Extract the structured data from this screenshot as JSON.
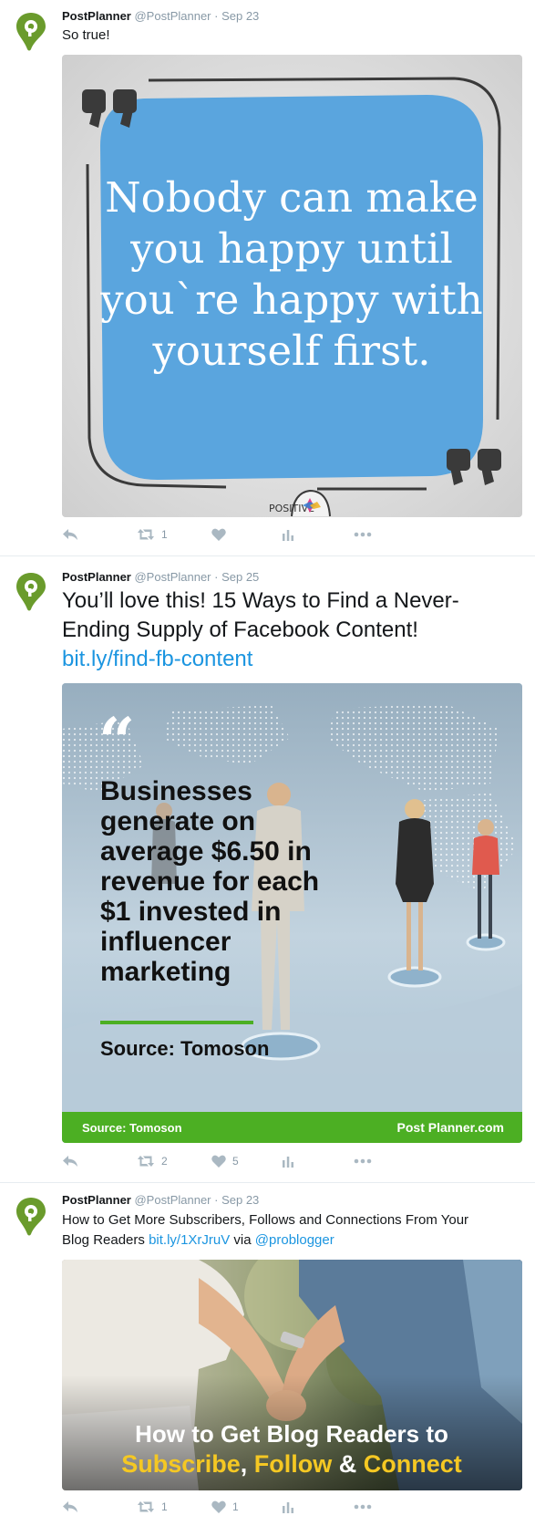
{
  "tweets": [
    {
      "name": "PostPlanner",
      "handle": "@PostPlanner",
      "date": "· Sep 23",
      "text": "So true!",
      "image": {
        "quote_lines": [
          "Nobody can make",
          "you happy until",
          "you`re happy with",
          "yourself first."
        ],
        "logo_text": "POSITIVE"
      },
      "actions": {
        "retweets": "1",
        "likes": ""
      }
    },
    {
      "name": "PostPlanner",
      "handle": "@PostPlanner",
      "date": "· Sep 25",
      "text_lines": [
        "You’ll love this! 15 Ways to Find a Never-",
        "Ending Supply of Facebook Content!"
      ],
      "link": "bit.ly/find-fb-content",
      "image": {
        "stat_lines": [
          "Businesses",
          "generate on",
          "average $6.50 in",
          "revenue for each",
          "$1 invested in",
          "influencer",
          "marketing"
        ],
        "source": "Source: Tomoson",
        "footer_left": "Source: Tomoson",
        "footer_right": "Post Planner.com",
        "accent": "#4caf23"
      },
      "actions": {
        "retweets": "2",
        "likes": "5"
      }
    },
    {
      "name": "PostPlanner",
      "handle": "@PostPlanner",
      "date": "· Sep 23",
      "text_line1": "How to Get More Subscribers, Follows and Connections From Your",
      "text_line2_prefix": "Blog Readers ",
      "link": "bit.ly/1XrJruV",
      "via": " via ",
      "mention": "@problogger",
      "image": {
        "title_line1": "How to Get Blog Readers to",
        "word_subscribe": "Subscribe",
        "comma": ", ",
        "word_follow": "Follow",
        "amp": " & ",
        "word_connect": "Connect"
      },
      "actions": {
        "retweets": "1",
        "likes": "1"
      }
    }
  ],
  "colors": {
    "brand_green": "#6a9b2c",
    "link": "#1b95e0",
    "action_gray": "#aab8c2",
    "quote_blue": "#5aa5de"
  }
}
